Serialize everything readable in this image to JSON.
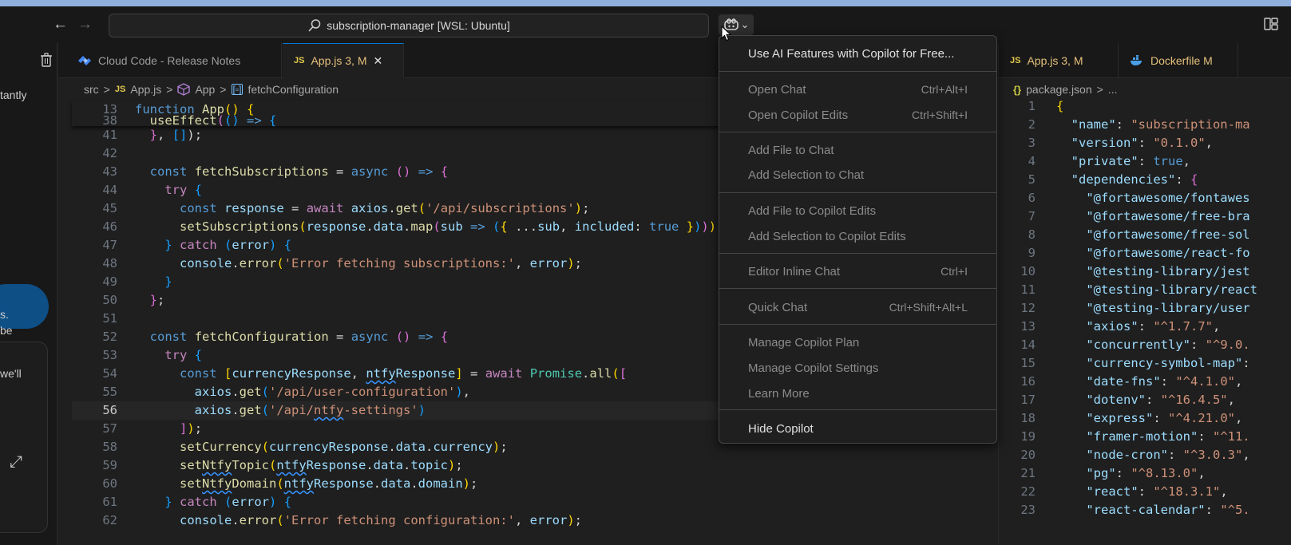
{
  "titlebar": {
    "back_glyph": "←",
    "forward_glyph": "→",
    "search_text": "subscription-manager [WSL: Ubuntu]",
    "copilot_chevron": "⌄"
  },
  "left_panel": {
    "text_1": "tantly",
    "text_2": "s.",
    "text_3": "be",
    "text_4": "we'll",
    "expand_glyph": "⤢"
  },
  "tabs": [
    {
      "label": "Cloud Code - Release Notes"
    },
    {
      "badge": "JS",
      "label": "App.js 3, M",
      "close": "✕"
    }
  ],
  "breadcrumb": {
    "folder": "src",
    "sep": ">",
    "badge": "JS",
    "file": "App.js",
    "component": "App",
    "symbol": "fetchConfiguration"
  },
  "copilot_menu": {
    "items": [
      {
        "label": "Use AI Features with Copilot for Free...",
        "shortcut": ""
      },
      {
        "label": "Open Chat",
        "shortcut": "Ctrl+Alt+I"
      },
      {
        "label": "Open Copilot Edits",
        "shortcut": "Ctrl+Shift+I"
      },
      {
        "label": "Add File to Chat",
        "shortcut": ""
      },
      {
        "label": "Add Selection to Chat",
        "shortcut": ""
      },
      {
        "label": "Add File to Copilot Edits",
        "shortcut": ""
      },
      {
        "label": "Add Selection to Copilot Edits",
        "shortcut": ""
      },
      {
        "label": "Editor Inline Chat",
        "shortcut": "Ctrl+I"
      },
      {
        "label": "Quick Chat",
        "shortcut": "Ctrl+Shift+Alt+L"
      },
      {
        "label": "Manage Copilot Plan",
        "shortcut": ""
      },
      {
        "label": "Manage Copilot Settings",
        "shortcut": ""
      },
      {
        "label": "Learn More",
        "shortcut": ""
      },
      {
        "label": "Hide Copilot",
        "shortcut": ""
      }
    ]
  },
  "right_tabs": [
    {
      "badge": "JS",
      "label": "App.js 3, M"
    },
    {
      "label": "Dockerfile M"
    }
  ],
  "right_breadcrumb": {
    "icon": "{}",
    "file": "package.json",
    "sep": ">",
    "rest": "..."
  },
  "editor": {
    "lines": [
      {
        "n": "13",
        "t": "function App() {"
      },
      {
        "n": "38",
        "t": "  useEffect(() => {"
      },
      {
        "n": "41",
        "t": "  }, []);"
      },
      {
        "n": "42",
        "t": ""
      },
      {
        "n": "43",
        "t": "  const fetchSubscriptions = async () => {"
      },
      {
        "n": "44",
        "t": "    try {"
      },
      {
        "n": "45",
        "t": "      const response = await axios.get('/api/subscriptions');"
      },
      {
        "n": "46",
        "t": "      setSubscriptions(response.data.map(sub => ({ ...sub, included: true })));"
      },
      {
        "n": "47",
        "t": "    } catch (error) {"
      },
      {
        "n": "48",
        "t": "      console.error('Error fetching subscriptions:', error);"
      },
      {
        "n": "49",
        "t": "    }"
      },
      {
        "n": "50",
        "t": "  };"
      },
      {
        "n": "51",
        "t": ""
      },
      {
        "n": "52",
        "t": "  const fetchConfiguration = async () => {"
      },
      {
        "n": "53",
        "t": "    try {"
      },
      {
        "n": "54",
        "t": "      const [currencyResponse, ntfyResponse] = await Promise.all(["
      },
      {
        "n": "55",
        "t": "        axios.get('/api/user-configuration'),"
      },
      {
        "n": "56",
        "t": "        axios.get('/api/ntfy-settings')"
      },
      {
        "n": "57",
        "t": "      ]);"
      },
      {
        "n": "58",
        "t": "      setCurrency(currencyResponse.data.currency);"
      },
      {
        "n": "59",
        "t": "      setNtfyTopic(ntfyResponse.data.topic);"
      },
      {
        "n": "60",
        "t": "      setNtfyDomain(ntfyResponse.data.domain);"
      },
      {
        "n": "61",
        "t": "    } catch (error) {"
      },
      {
        "n": "62",
        "t": "      console.error('Error fetching configuration:', error);"
      }
    ]
  },
  "package_json": {
    "lines": [
      {
        "n": "1",
        "t": "{"
      },
      {
        "n": "2",
        "t": "  \"name\": \"subscription-ma"
      },
      {
        "n": "3",
        "t": "  \"version\": \"0.1.0\","
      },
      {
        "n": "4",
        "t": "  \"private\": true,"
      },
      {
        "n": "5",
        "t": "  \"dependencies\": {"
      },
      {
        "n": "6",
        "t": "    \"@fortawesome/fontawes"
      },
      {
        "n": "7",
        "t": "    \"@fortawesome/free-bra"
      },
      {
        "n": "8",
        "t": "    \"@fortawesome/free-sol"
      },
      {
        "n": "9",
        "t": "    \"@fortawesome/react-fo"
      },
      {
        "n": "10",
        "t": "    \"@testing-library/jest"
      },
      {
        "n": "11",
        "t": "    \"@testing-library/react"
      },
      {
        "n": "12",
        "t": "    \"@testing-library/user"
      },
      {
        "n": "13",
        "t": "    \"axios\": \"^1.7.7\","
      },
      {
        "n": "14",
        "t": "    \"concurrently\": \"^9.0."
      },
      {
        "n": "15",
        "t": "    \"currency-symbol-map\":"
      },
      {
        "n": "16",
        "t": "    \"date-fns\": \"^4.1.0\","
      },
      {
        "n": "17",
        "t": "    \"dotenv\": \"^16.4.5\","
      },
      {
        "n": "18",
        "t": "    \"express\": \"^4.21.0\","
      },
      {
        "n": "19",
        "t": "    \"framer-motion\": \"^11."
      },
      {
        "n": "20",
        "t": "    \"node-cron\": \"^3.0.3\","
      },
      {
        "n": "21",
        "t": "    \"pg\": \"^8.13.0\","
      },
      {
        "n": "22",
        "t": "    \"react\": \"^18.3.1\","
      },
      {
        "n": "23",
        "t": "    \"react-calendar\": \"^5."
      }
    ]
  }
}
